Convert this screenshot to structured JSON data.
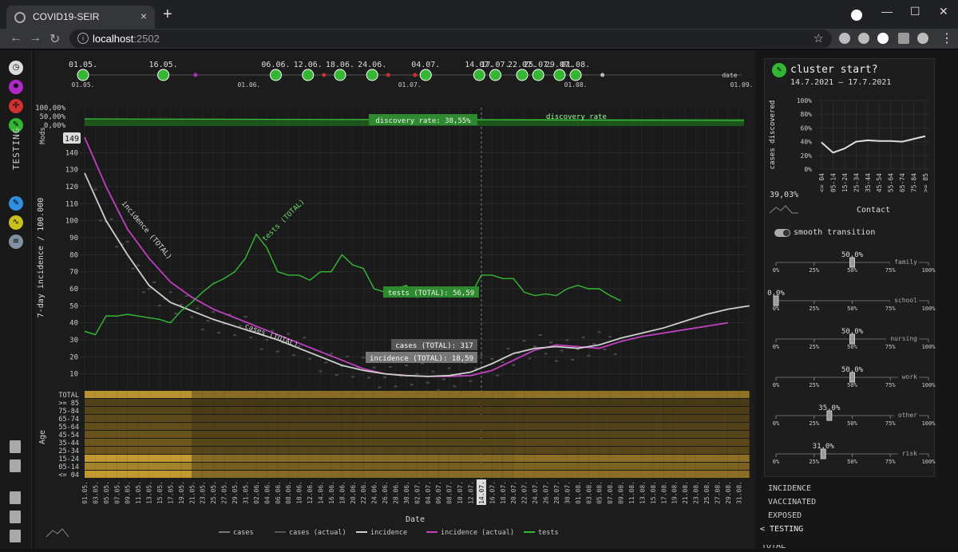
{
  "browser": {
    "tab_title": "COVID19-SEIR",
    "new_tab": "+",
    "url_host": "localhost",
    "url_port": ":2502",
    "close_tab": "×",
    "minimize": "—",
    "maximize": "☐",
    "close_window": "✕"
  },
  "leftbar": {
    "mode_label": "TESTING"
  },
  "timeline": {
    "top_labels": [
      "01.05.",
      "16.05.",
      "06.06.",
      "12.06.",
      "18.06.",
      "24.06.",
      "04.07.",
      "14.07.",
      "17.07.",
      "22.07.",
      "25.07.",
      "29.07.",
      "01.08."
    ],
    "axis_labels": [
      "01.05.",
      "01.06.",
      "01.07.",
      "01.08.",
      "01.09."
    ],
    "date_label": "date"
  },
  "chart_data": {
    "type": "line",
    "ylabel": "7-day incidence / 100.000",
    "xlabel": "Date",
    "mods_label": "Mods",
    "mods_ticks": [
      "100,00%",
      "50,00%",
      "0,00%"
    ],
    "y_ticks": [
      10,
      20,
      30,
      40,
      50,
      60,
      70,
      80,
      90,
      100,
      110,
      120,
      130,
      140
    ],
    "y_top_marker": "149",
    "ylim": [
      0,
      150
    ],
    "x_ticks": [
      "01.05.",
      "03.05.",
      "05.05.",
      "07.05.",
      "09.05.",
      "11.05.",
      "13.05.",
      "15.05.",
      "17.05.",
      "19.05.",
      "21.05.",
      "23.05.",
      "25.05.",
      "27.05.",
      "29.05.",
      "31.05.",
      "02.06.",
      "04.06.",
      "06.06.",
      "08.06.",
      "10.06.",
      "12.06.",
      "14.06.",
      "16.06.",
      "18.06.",
      "20.06.",
      "22.06.",
      "24.06.",
      "26.06.",
      "28.06.",
      "30.06.",
      "02.07.",
      "04.07.",
      "06.07.",
      "08.07.",
      "10.07.",
      "12.07.",
      "14.07.",
      "16.07.",
      "18.07.",
      "20.07.",
      "22.07.",
      "24.07.",
      "26.07.",
      "28.07.",
      "30.07.",
      "01.08.",
      "03.08.",
      "05.08.",
      "07.08.",
      "09.08.",
      "11.08.",
      "13.08.",
      "15.08.",
      "17.08.",
      "19.08.",
      "21.08.",
      "23.08.",
      "25.08.",
      "27.08.",
      "29.08.",
      "31.08."
    ],
    "current_date": "14.07.",
    "series": [
      {
        "name": "incidence (actual)",
        "color": "#c040c0",
        "x": [
          0,
          4,
          8,
          12,
          16,
          20,
          24,
          28,
          32,
          36,
          40,
          44,
          48,
          52,
          56,
          60,
          64,
          68,
          72,
          76,
          80,
          84,
          88,
          92,
          96,
          100,
          104,
          108,
          112,
          116,
          120
        ],
        "values": [
          149,
          120,
          95,
          78,
          64,
          55,
          48,
          43,
          38,
          33,
          28,
          23,
          18,
          13,
          10,
          9,
          8.5,
          8.5,
          9,
          12,
          18,
          24,
          27,
          26,
          25,
          29,
          32,
          34,
          36,
          38,
          40
        ]
      },
      {
        "name": "incidence",
        "color": "#cfcfcf",
        "x": [
          0,
          4,
          8,
          12,
          16,
          20,
          24,
          28,
          32,
          36,
          40,
          44,
          48,
          52,
          56,
          60,
          64,
          68,
          72,
          76,
          80,
          84,
          88,
          92,
          96,
          100,
          104,
          108,
          112,
          116,
          120,
          124
        ],
        "values": [
          128,
          100,
          80,
          62,
          52,
          47,
          42,
          38,
          34,
          30,
          25,
          20,
          15,
          12,
          10,
          9,
          8.5,
          9,
          11,
          16,
          22,
          25,
          26,
          25,
          27,
          31,
          34,
          37,
          41,
          45,
          48,
          50
        ]
      },
      {
        "name": "tests",
        "color": "#33bb33",
        "x": [
          0,
          2,
          4,
          6,
          8,
          10,
          12,
          14,
          16,
          18,
          20,
          22,
          24,
          26,
          28,
          30,
          32,
          34,
          36,
          38,
          40,
          42,
          44,
          46,
          48,
          50,
          52,
          54,
          56,
          58,
          60,
          62,
          64,
          66,
          68,
          70,
          72,
          74,
          76,
          78,
          80,
          82,
          84,
          86,
          88,
          90,
          92,
          94,
          96,
          98,
          100
        ],
        "values": [
          35,
          33,
          44,
          44,
          45,
          44,
          43,
          42,
          40,
          47,
          52,
          58,
          63,
          66,
          70,
          78,
          92,
          84,
          70,
          68,
          68,
          65,
          70,
          70,
          80,
          74,
          72,
          60,
          58,
          60,
          62,
          55,
          56,
          58,
          57,
          56,
          56,
          68,
          68,
          66,
          66,
          58,
          56,
          57,
          56,
          60,
          62,
          60,
          60,
          56,
          53
        ]
      }
    ],
    "labels": {
      "discovery_rate_box": "discovery rate: 38,55%",
      "discovery_rate": "discovery rate",
      "tests_total": "tests (TOTAL): 56,59",
      "cases_total": "cases (TOTAL): 317",
      "incidence_total": "incidence (TOTAL): 18,59",
      "incidence_curve": "incidence (TOTAL)",
      "tests_curve": "tests (TOTAL)",
      "cases_curve": "cases (TOTAL)"
    },
    "heatmap": {
      "age_label": "Age",
      "rows": [
        "TOTAL",
        ">= 85",
        "75-84",
        "65-74",
        "55-64",
        "45-54",
        "35-44",
        "25-34",
        "15-24",
        "05-14",
        "<= 04"
      ]
    },
    "legend": [
      "cases",
      "cases (actual)",
      "incidence",
      "incidence (actual)",
      "tests"
    ]
  },
  "rightpanel": {
    "title": "cluster start?",
    "date_range": "14.7.2021 – 17.7.2021",
    "ylabel": "cases discovered",
    "y_ticks": [
      "100%",
      "80%",
      "60%",
      "40%",
      "20%",
      "0%"
    ],
    "x_ticks": [
      "<= 04",
      "05-14",
      "15-24",
      "25-34",
      "35-44",
      "45-54",
      "55-64",
      "65-74",
      "75-84",
      ">= 85"
    ],
    "values": [
      39,
      24,
      30,
      40,
      42,
      41,
      41,
      40,
      44,
      48
    ],
    "pct": "39,03%",
    "contact": "Contact",
    "smooth_label": "smooth transition",
    "sliders": [
      {
        "name": "family",
        "value": "50,0%",
        "level": 0.5
      },
      {
        "name": "school",
        "value": "0,0%",
        "level": 0.0
      },
      {
        "name": "nursing",
        "value": "50,0%",
        "level": 0.5
      },
      {
        "name": "work",
        "value": "50,0%",
        "level": 0.5
      },
      {
        "name": "other",
        "value": "35,0%",
        "level": 0.35
      },
      {
        "name": "risk",
        "value": "31,0%",
        "level": 0.31
      }
    ],
    "slider_ticks": [
      "0%",
      "25%",
      "50%",
      "75%",
      "100%"
    ]
  },
  "menu": {
    "items": [
      "INCIDENCE",
      "VACCINATED",
      "EXPOSED",
      "< TESTING"
    ],
    "partial": "TOTAL"
  }
}
